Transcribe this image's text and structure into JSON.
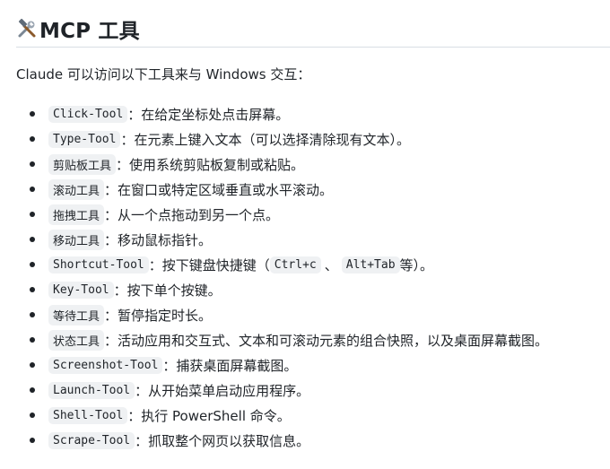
{
  "heading": {
    "icon": "hammer-and-wrench-icon",
    "title": "MCP 工具"
  },
  "intro": "Claude 可以访问以下工具来与 Windows 交互：",
  "tools": [
    {
      "name": "Click-Tool",
      "desc": "：在给定坐标处点击屏幕。"
    },
    {
      "name": "Type-Tool",
      "desc": "：在元素上键入文本（可以选择清除现有文本）。"
    },
    {
      "name": "剪贴板工具",
      "desc": "：使用系统剪贴板复制或粘贴。"
    },
    {
      "name": "滚动工具",
      "desc": "：在窗口或特定区域垂直或水平滚动。"
    },
    {
      "name": "拖拽工具",
      "desc": "：从一个点拖动到另一个点。"
    },
    {
      "name": "移动工具",
      "desc": "：移动鼠标指针。"
    },
    {
      "name": "Shortcut-Tool",
      "desc_before": "：按下键盘快捷键（",
      "key1": "Ctrl+c",
      "sep": "、",
      "key2": "Alt+Tab",
      "desc_after": "等）。"
    },
    {
      "name": "Key-Tool",
      "desc": "：按下单个按键。"
    },
    {
      "name": "等待工具",
      "desc": "：暂停指定时长。"
    },
    {
      "name": "状态工具",
      "desc": "：活动应用和交互式、文本和可滚动元素的组合快照，以及桌面屏幕截图。"
    },
    {
      "name": "Screenshot-Tool",
      "desc": "：捕获桌面屏幕截图。"
    },
    {
      "name": "Launch-Tool",
      "desc": "：从开始菜单启动应用程序。"
    },
    {
      "name": "Shell-Tool",
      "desc": "：执行 PowerShell 命令。"
    },
    {
      "name": "Scrape-Tool",
      "desc": "：抓取整个网页以获取信息。"
    }
  ]
}
